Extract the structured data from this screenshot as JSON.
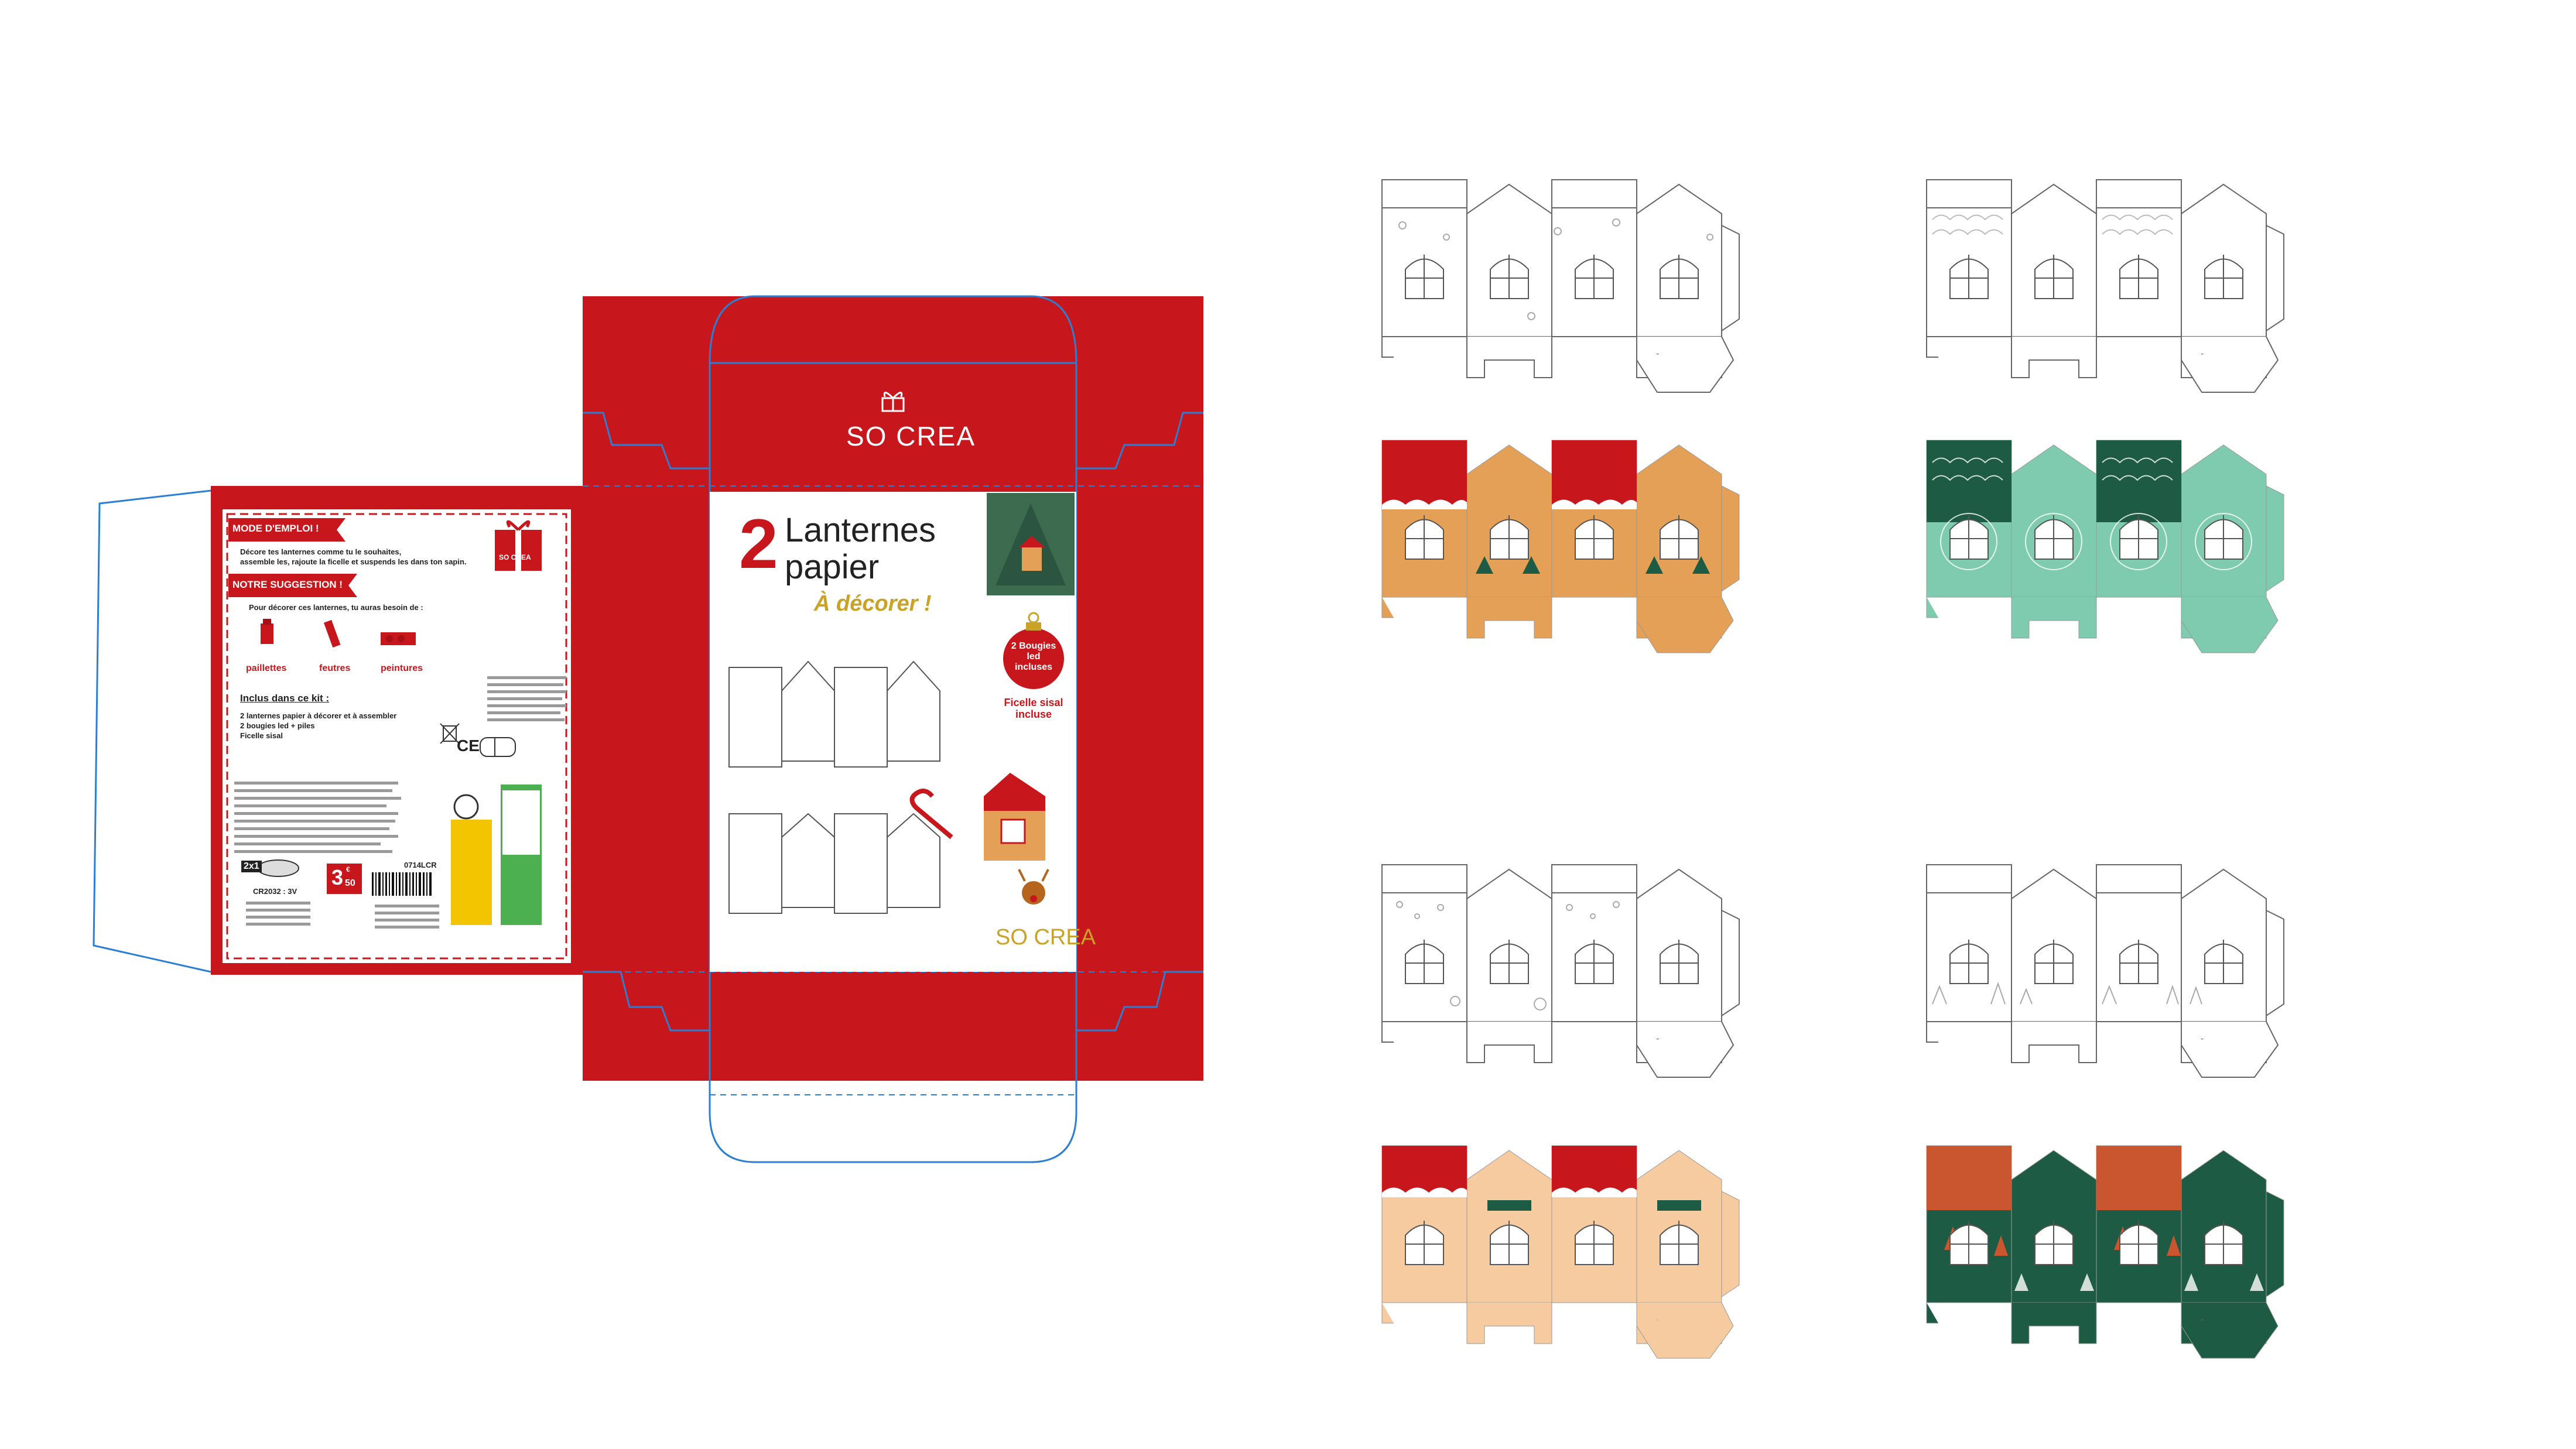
{
  "colors": {
    "red": "#c8161d",
    "dark_red": "#a80f16",
    "gold": "#c9a227",
    "orange": "#e4a057",
    "mint": "#7fcbb0",
    "dark_green": "#1e5b45",
    "brick": "#c9562f",
    "peach": "#f6cba0",
    "cut_blue": "#2a7fd4"
  },
  "box": {
    "brand": "SO CREA",
    "front": {
      "number": "2",
      "line1": "Lanternes",
      "line2": "papier",
      "tagline": "À décorer !",
      "led_badge": "2 Bougies led incluses",
      "sisal_label": "Ficelle sisal incluse",
      "brand": "SO CREA"
    },
    "back": {
      "mode_title": "MODE D'EMPLOI !",
      "mode_text_1": "Décore tes lanternes comme tu le souhaites,",
      "mode_text_2": "assemble les, rajoute la ficelle et suspends les dans ton sapin.",
      "suggestion_title": "NOTRE SUGGESTION !",
      "suggestion_text": "Pour décorer ces lanternes, tu auras besoin de :",
      "tools": [
        "paillettes",
        "feutres",
        "peintures"
      ],
      "kit_title": "Inclus dans ce kit :",
      "kit_items": [
        "2 lanternes papier à décorer et à assembler",
        "2 bougies led + piles",
        "Ficelle sisal"
      ],
      "battery_count": "2x1",
      "battery_type": "CR2032 : 3V",
      "ce_mark": "CE",
      "price_main": "3",
      "price_cents": "50",
      "price_currency": "€",
      "ref": "0714LCR",
      "logo_small": "SO CREA"
    }
  }
}
